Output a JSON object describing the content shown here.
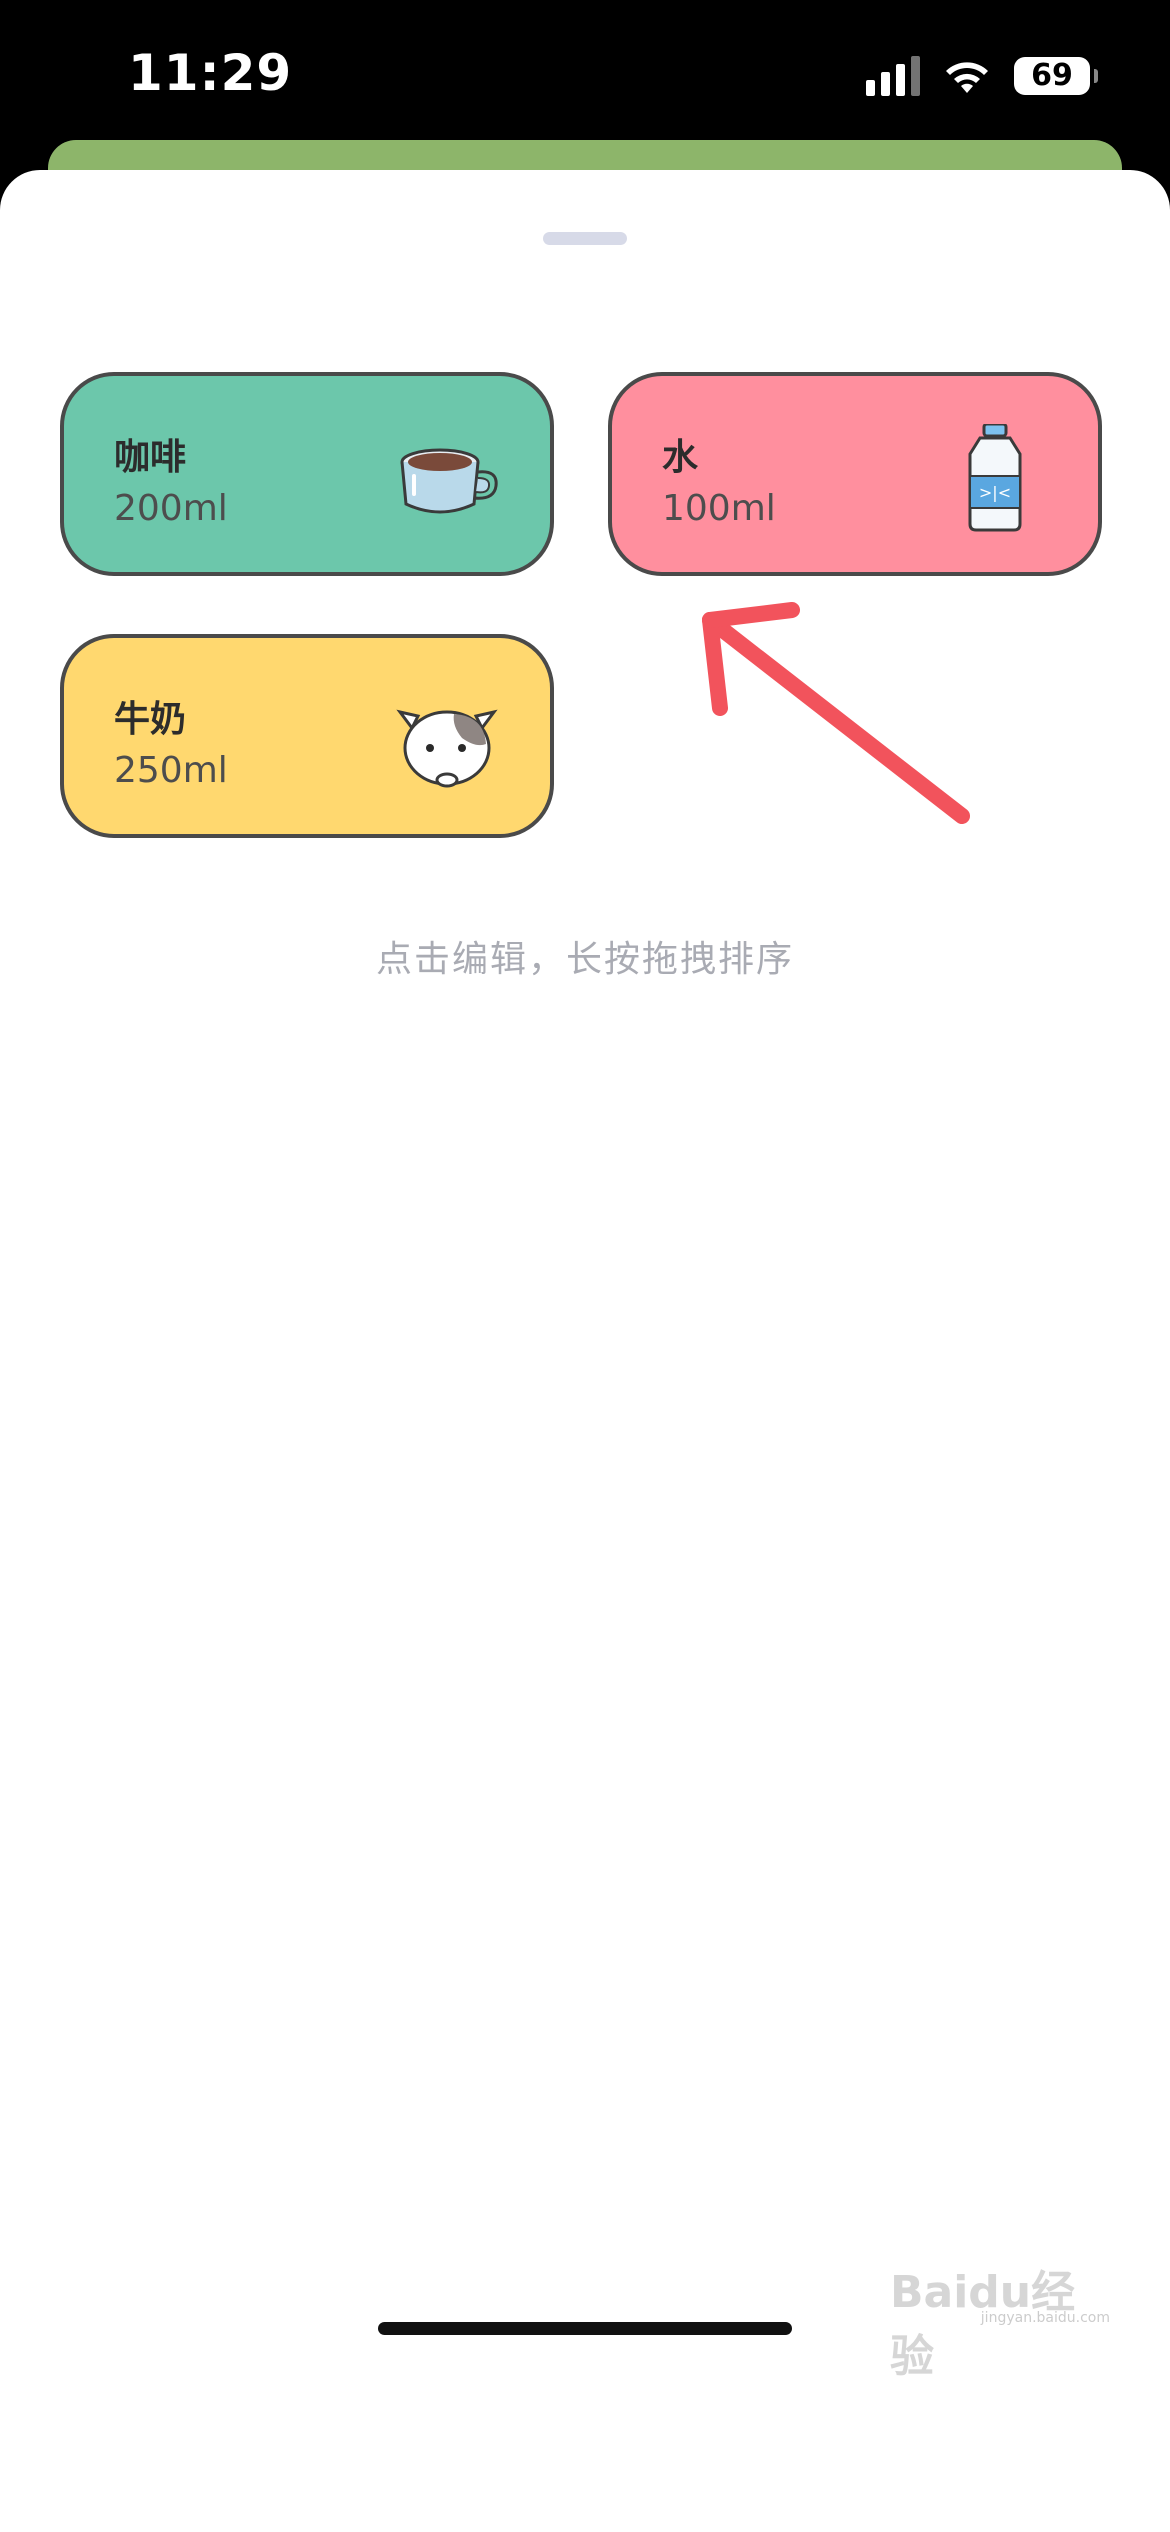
{
  "status_bar": {
    "time": "11:29",
    "battery": "69",
    "icons": [
      "cellular-signal-icon",
      "wifi-icon",
      "battery-icon"
    ]
  },
  "sheet": {
    "cards": [
      {
        "name": "咖啡",
        "amount": "200ml",
        "color": "#6cc7ab",
        "icon": "coffee-cup-icon"
      },
      {
        "name": "水",
        "amount": "100ml",
        "color": "#ff8f9e",
        "icon": "water-bottle-icon"
      },
      {
        "name": "牛奶",
        "amount": "250ml",
        "color": "#ffd86f",
        "icon": "cow-icon"
      }
    ],
    "hint": "点击编辑，长按拖拽排序"
  },
  "annotation": {
    "arrow_color": "#f2535c",
    "arrow_icon": "red-arrow-icon"
  },
  "watermark": {
    "logo": "Baidu经验",
    "sub": "jingyan.baidu.com"
  },
  "colors": {
    "underlay": "#8db56a",
    "grabber": "#d7dae8",
    "hint_text": "#a9abb3"
  }
}
